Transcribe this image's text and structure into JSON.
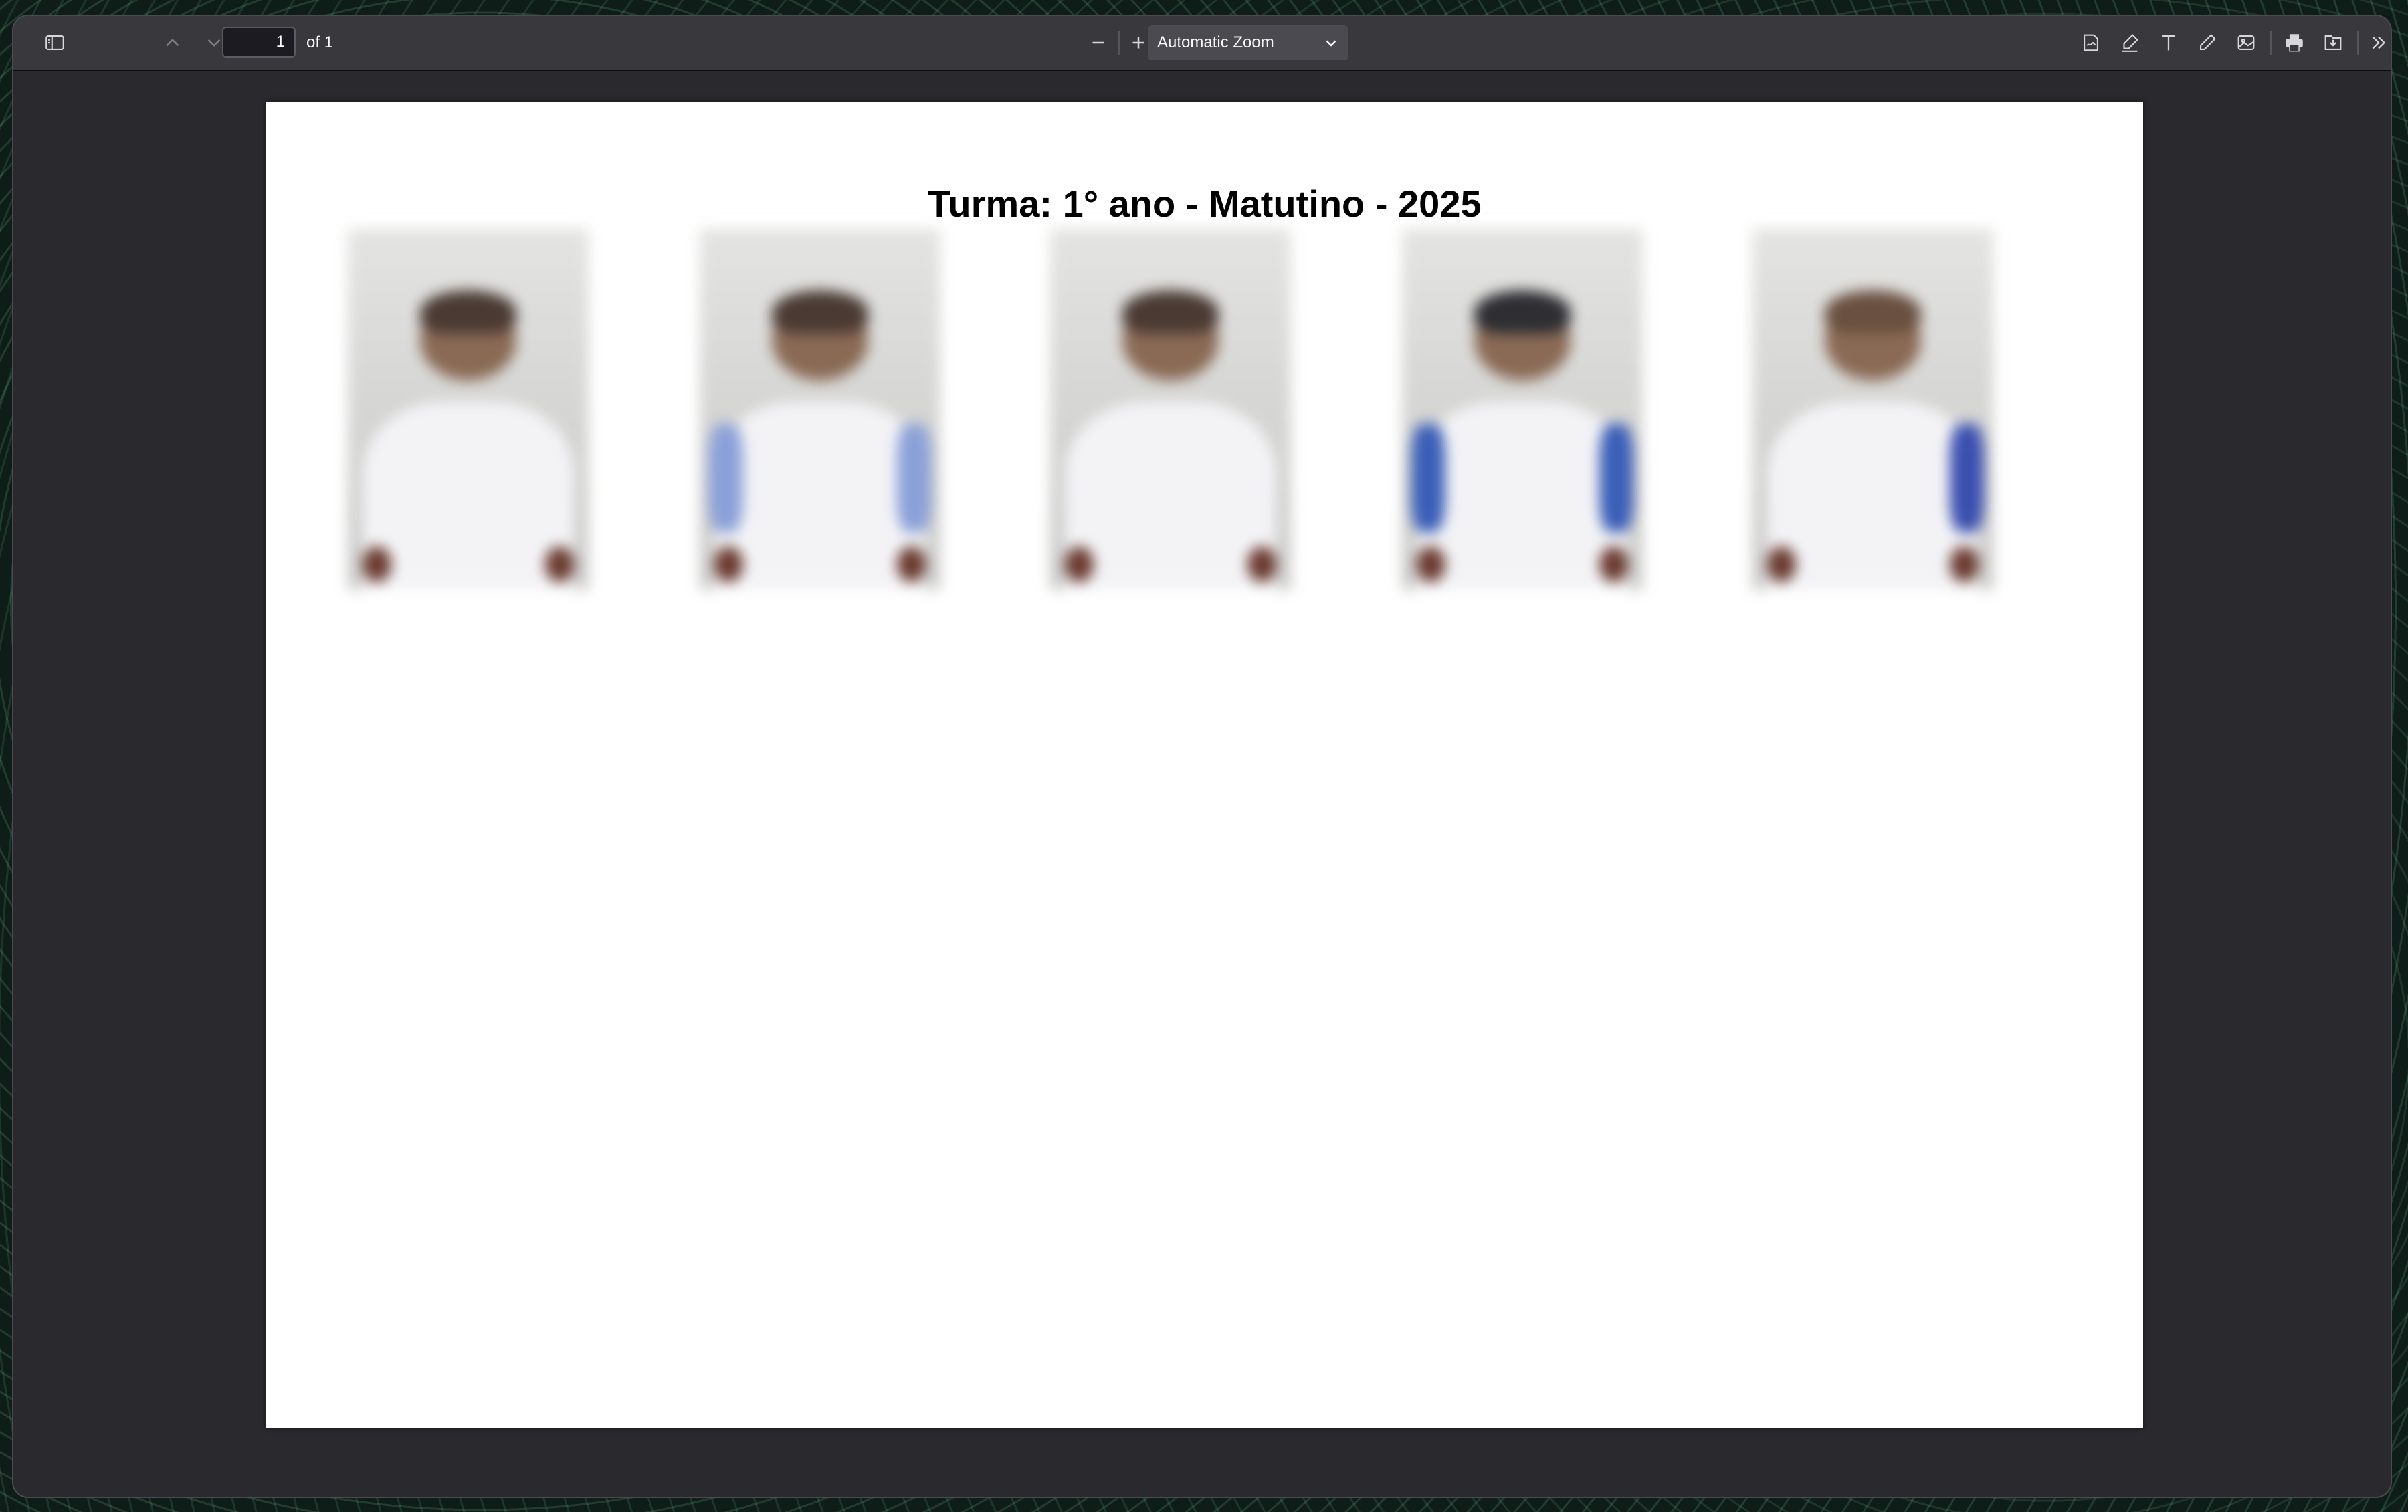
{
  "toolbar": {
    "page_number": "1",
    "page_count_label": "of 1",
    "zoom_label": "Automatic Zoom"
  },
  "icons": {
    "sidebar": "sidebar-toggle-icon",
    "prev": "chevron-up-icon",
    "next": "chevron-down-icon",
    "zoom_out": "minus-icon",
    "zoom_in": "plus-icon",
    "signature": "signature-icon",
    "highlight": "highlight-icon",
    "text": "text-icon",
    "draw": "draw-icon",
    "image": "image-icon",
    "print": "print-icon",
    "save": "save-icon",
    "more": "double-chevron-right-icon"
  },
  "document": {
    "title": "Turma: 1° ano - Matutino - 2025",
    "students": [
      {
        "caption": ""
      },
      {
        "caption": ""
      },
      {
        "caption": ""
      },
      {
        "caption": ""
      },
      {
        "caption": ""
      }
    ]
  }
}
